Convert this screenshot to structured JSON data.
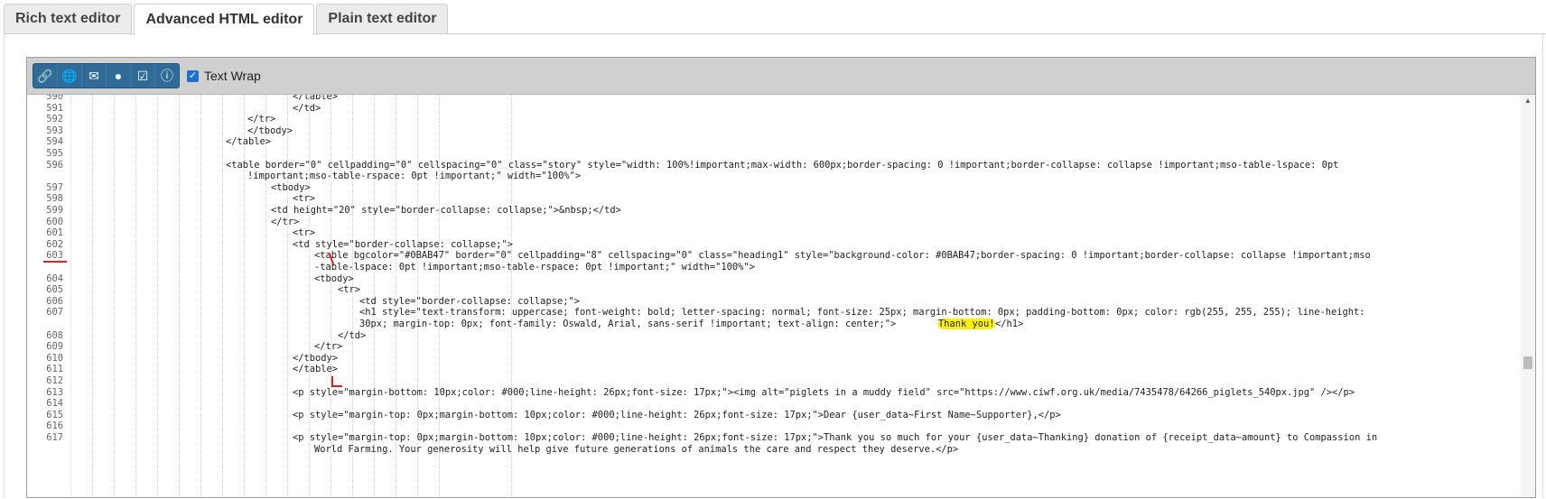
{
  "tabs": [
    {
      "label": "Rich text editor"
    },
    {
      "label": "Advanced HTML editor"
    },
    {
      "label": "Plain text editor"
    }
  ],
  "toolbar": {
    "icons": [
      "link-icon",
      "globe-icon",
      "envelope-check-icon",
      "user-icon",
      "checkbox-icon",
      "info-icon"
    ],
    "text_wrap_label": "Text Wrap",
    "text_wrap_checked": true
  },
  "editor": {
    "lines": [
      {
        "num": "590",
        "code": "</table>"
      },
      {
        "num": "591",
        "code": "</td>"
      },
      {
        "num": "592",
        "code": "</tr>"
      },
      {
        "num": "593",
        "code": "</tbody>"
      },
      {
        "num": "594",
        "code": "</table>"
      },
      {
        "num": "595",
        "code": ""
      },
      {
        "num": "596",
        "code": "<table border=\"0\" cellpadding=\"0\" cellspacing=\"0\" class=\"story\" style=\"width: 100%!important;max-width: 600px;border-spacing: 0 !important;border-collapse: collapse !important;mso-table-lspace: 0pt"
      },
      {
        "num": "",
        "code": "!important;mso-table-rspace: 0pt !important;\" width=\"100%\">"
      },
      {
        "num": "597",
        "code": "<tbody>"
      },
      {
        "num": "598",
        "code": "<tr>"
      },
      {
        "num": "599",
        "code": "<td height=\"20\" style=\"border-collapse: collapse;\">&nbsp;</td>"
      },
      {
        "num": "600",
        "code": "</tr>"
      },
      {
        "num": "601",
        "code": "<tr>"
      },
      {
        "num": "602",
        "code": "<td style=\"border-collapse: collapse;\">"
      },
      {
        "num": "603",
        "code": "<table bgcolor=\"#0BAB47\" border=\"0\" cellpadding=\"8\" cellspacing=\"0\" class=\"heading1\" style=\"background-color: #0BAB47;border-spacing: 0 !important;border-collapse: collapse !important;mso"
      },
      {
        "num": "",
        "code": "-table-lspace: 0pt !important;mso-table-rspace: 0pt !important;\" width=\"100%\">"
      },
      {
        "num": "604",
        "code": "<tbody>"
      },
      {
        "num": "605",
        "code": "<tr>"
      },
      {
        "num": "606",
        "code": "<td style=\"border-collapse: collapse;\">"
      },
      {
        "num": "607",
        "code": "<h1 style=\"text-transform: uppercase; font-weight: bold; letter-spacing: normal; font-size: 25px; margin-bottom: 0px; padding-bottom: 0px; color: rgb(255, 255, 255); line-height:"
      },
      {
        "num": "",
        "code": "30px; margin-top: 0px; font-family: Oswald, Arial, sans-serif !important; text-align: center;\">",
        "highlight": "Thank you!",
        "tail": "</h1>"
      },
      {
        "num": "608",
        "code": "</td>"
      },
      {
        "num": "609",
        "code": "</tr>"
      },
      {
        "num": "610",
        "code": "</tbody>"
      },
      {
        "num": "611",
        "code": "</table>"
      },
      {
        "num": "612",
        "code": ""
      },
      {
        "num": "613",
        "code": "<p style=\"margin-bottom: 10px;color: #000;line-height: 26px;font-size: 17px;\"><img alt=\"piglets in a muddy field\" src=\"https://www.ciwf.org.uk/media/7435478/64266_piglets_540px.jpg\" /></p>"
      },
      {
        "num": "614",
        "code": ""
      },
      {
        "num": "615",
        "code": "<p style=\"margin-top: 0px;margin-bottom: 10px;color: #000;line-height: 26px;font-size: 17px;\">Dear {user_data~First Name~Supporter},</p>"
      },
      {
        "num": "616",
        "code": ""
      },
      {
        "num": "617",
        "code": "<p style=\"margin-top: 0px;margin-bottom: 10px;color: #000;line-height: 26px;font-size: 17px;\">Thank you so much for your {user_data~Thanking} donation of {receipt_data~amount} to Compassion in"
      },
      {
        "num": "",
        "code": "World Farming. Your generosity will help give future generations of animals the care and respect they deserve.</p>"
      }
    ]
  }
}
